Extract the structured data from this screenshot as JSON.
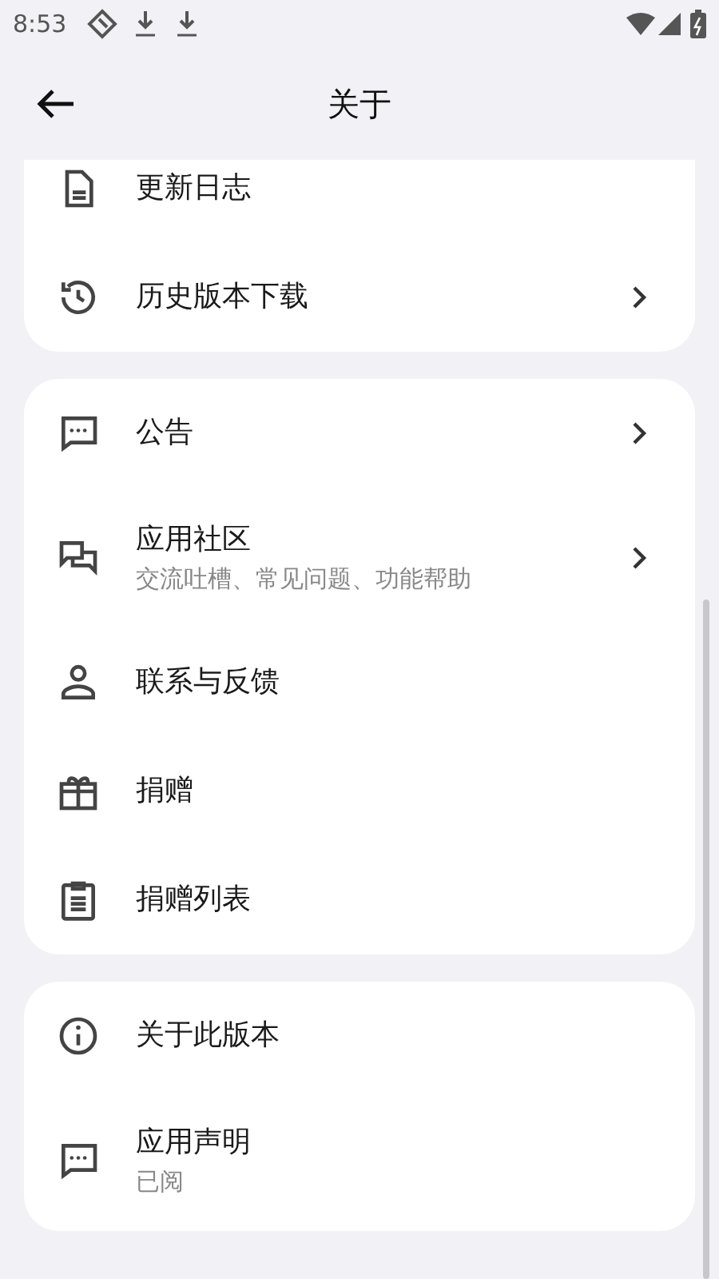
{
  "status_bar": {
    "time": "8:53"
  },
  "header": {
    "title": "关于"
  },
  "groups": [
    {
      "items": [
        {
          "label": "更新日志",
          "chevron": false
        },
        {
          "label": "历史版本下载",
          "chevron": true
        }
      ]
    },
    {
      "items": [
        {
          "label": "公告",
          "chevron": true
        },
        {
          "label": "应用社区",
          "subtitle": "交流吐槽、常见问题、功能帮助",
          "chevron": true
        },
        {
          "label": "联系与反馈",
          "chevron": false
        },
        {
          "label": "捐赠",
          "chevron": false
        },
        {
          "label": "捐赠列表",
          "chevron": false
        }
      ]
    },
    {
      "items": [
        {
          "label": "关于此版本",
          "chevron": false
        },
        {
          "label": "应用声明",
          "subtitle": "已阅",
          "chevron": false
        }
      ]
    }
  ]
}
